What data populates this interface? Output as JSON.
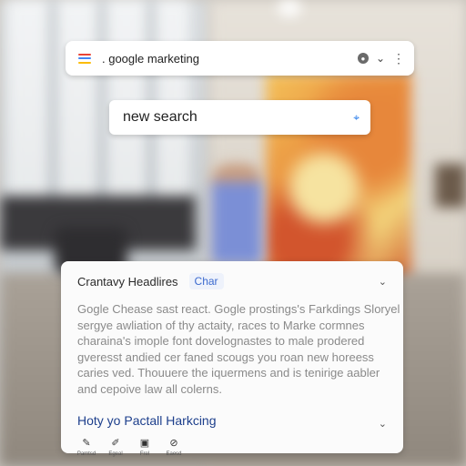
{
  "topbar": {
    "query": ". google marketing",
    "menu_icon": "hamburger-menu-icon",
    "mic_icon": "microphone-icon",
    "caret": "⌄",
    "kebab": "⋮",
    "menu_colors": [
      "#ea4335",
      "#4285f4",
      "#fbbc05"
    ]
  },
  "new_search": {
    "text": "new search",
    "icon": "lens-icon",
    "icon_color": "#1a73e8"
  },
  "card": {
    "title": "Crantavy Headlires",
    "chip": "Char",
    "body_lines": [
      "Gogle Chease sast react. Gogle prostings's Farkdings Sloryel",
      "sergye awliation of thy actaity, races to Marke cormnes",
      "charaina's imople font dovelognastes to male prodered",
      "gveresst andied cer faned scougs you roan new horeess",
      "caries ved. Thouuere the iquermens and is tenirige aabler",
      "and cepoive law all colerns."
    ],
    "link": "Hoty yo Pactall Harkcing",
    "actions": [
      {
        "icon": "pencil-icon",
        "label": "Pamtsd"
      },
      {
        "icon": "brush-icon",
        "label": "Egeal"
      },
      {
        "icon": "image-icon",
        "label": "Frel"
      },
      {
        "icon": "compass-icon",
        "label": "Eaesd"
      }
    ]
  }
}
